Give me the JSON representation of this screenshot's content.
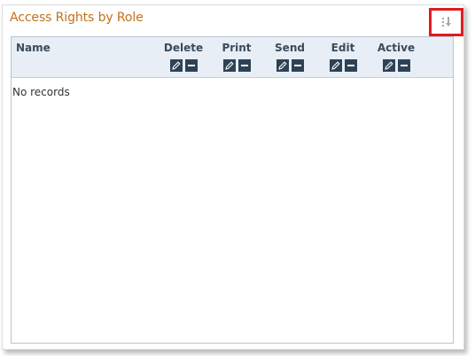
{
  "panel": {
    "title": "Access Rights by Role"
  },
  "grid": {
    "name_header": "Name",
    "columns": [
      {
        "label": "Delete"
      },
      {
        "label": "Print"
      },
      {
        "label": "Send"
      },
      {
        "label": "Edit"
      },
      {
        "label": "Active"
      }
    ],
    "empty_text": "No records"
  },
  "colors": {
    "title": "#c1711a",
    "highlight_border": "#e01b22",
    "header_bg": "#e7eef5",
    "action_button": "#2f4255"
  },
  "icons": {
    "sort": "sort-icon",
    "edit": "pencil-icon",
    "remove": "minus-icon"
  }
}
